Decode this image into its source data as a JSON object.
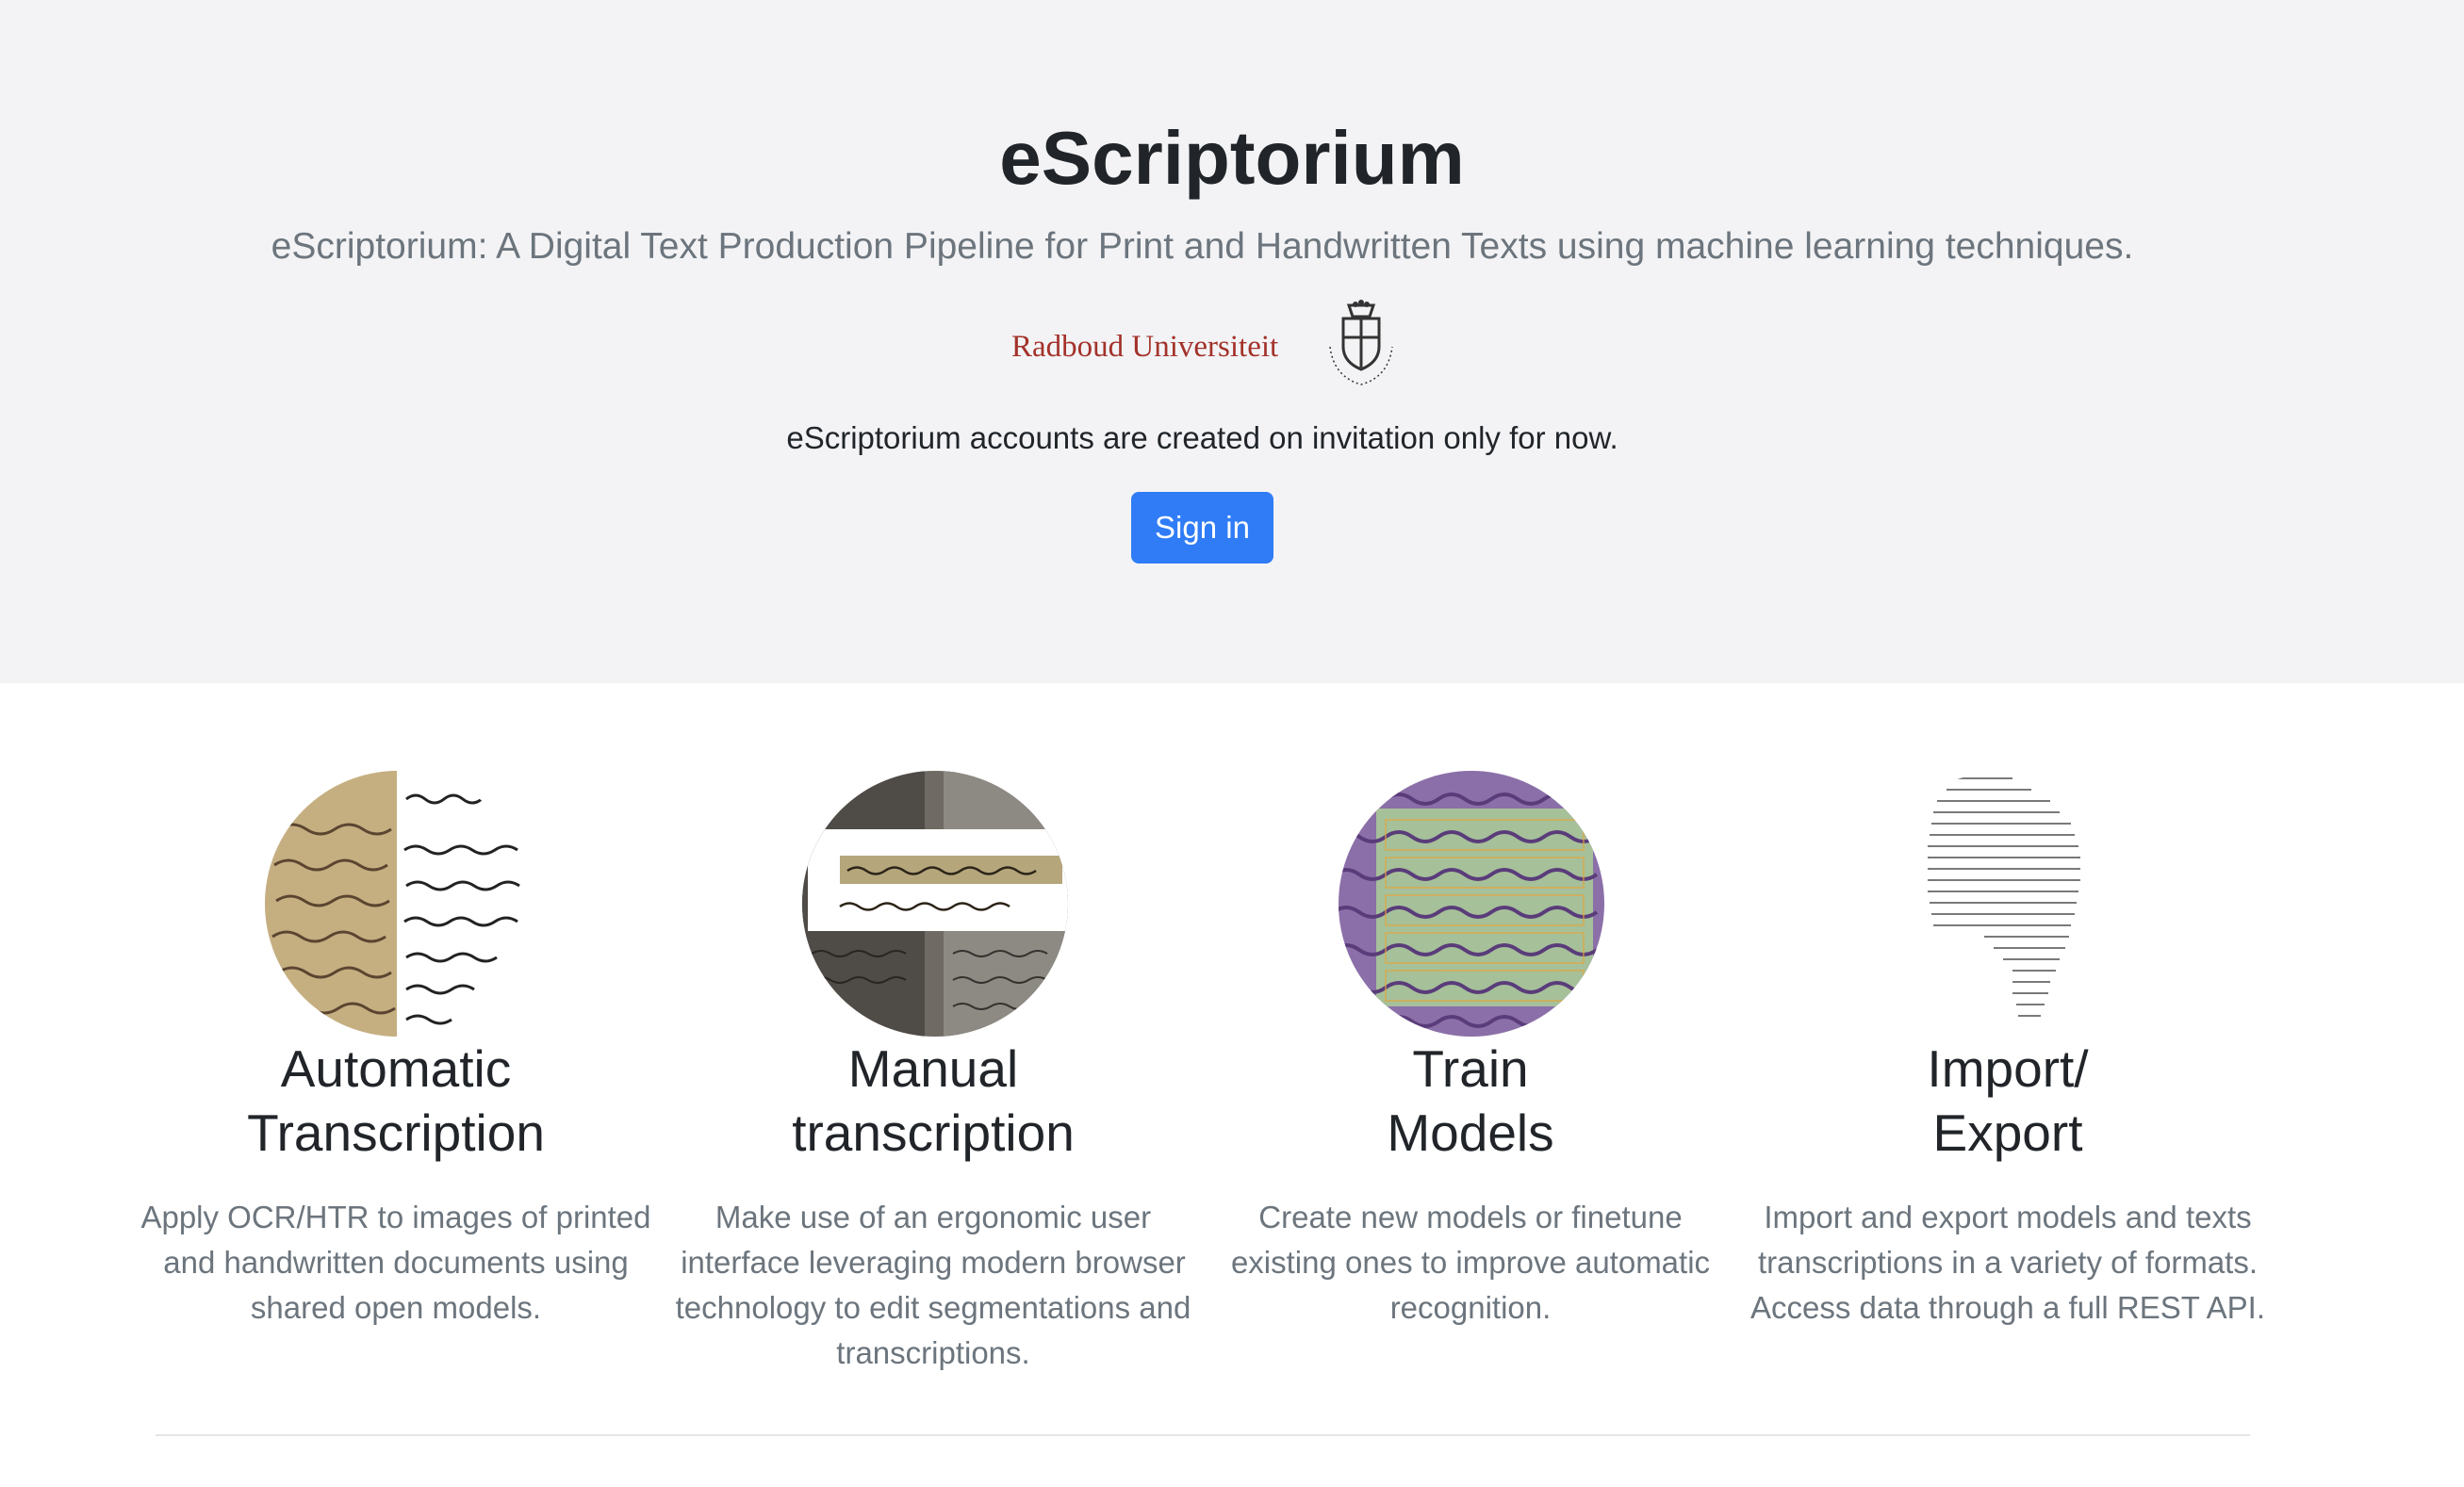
{
  "hero": {
    "title": "eScriptorium",
    "subtitle": "eScriptorium: A Digital Text Production Pipeline for Print and Handwritten Texts using machine learning techniques.",
    "logo_text": "Radboud Universiteit",
    "note": "eScriptorium accounts are created on invitation only for now.",
    "signin_label": "Sign in",
    "accent_color": "#2f7cf6",
    "logo_color": "#a3322a"
  },
  "features": [
    {
      "icon": "manuscript-transcription-image",
      "title_line1": "Automatic",
      "title_line2": "Transcription",
      "description": "Apply OCR/HTR to images of printed and handwritten documents using shared open models."
    },
    {
      "icon": "manual-transcription-image",
      "title_line1": "Manual",
      "title_line2": "transcription",
      "description": "Make use of an ergonomic user interface leveraging modern browser technology to edit segmentations and transcriptions."
    },
    {
      "icon": "train-models-image",
      "title_line1": "Train",
      "title_line2": "Models",
      "description": "Create new models or finetune existing ones to improve automatic recognition."
    },
    {
      "icon": "import-export-image",
      "title_line1": "Import/",
      "title_line2": "Export",
      "description": "Import and export models and texts transcriptions in a variety of formats. Access data through a full REST API."
    }
  ]
}
